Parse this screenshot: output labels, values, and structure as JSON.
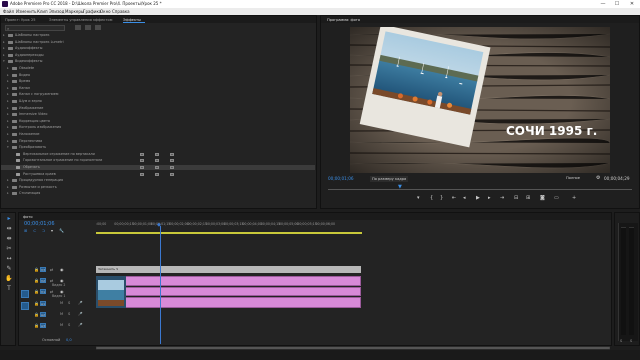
{
  "titlebar": {
    "title": "Adobe Premiere Pro CC 2018 - D:\\Школа Premier Pro\\4. Проекты\\Урок 25 *",
    "min": "—",
    "max": "☐",
    "close": "✕"
  },
  "menu": [
    "Файл",
    "Изменить",
    "Клип",
    "Эпизод",
    "Маркеры",
    "Графика",
    "Окно",
    "Справка"
  ],
  "effects_panel": {
    "tabs": [
      "Проект: Урок 25",
      "Элементы управления эффектом",
      "Эффекты"
    ],
    "tree": [
      {
        "label": "Шаблоны настроек",
        "level": 1,
        "open": false
      },
      {
        "label": "Шаблоны настроек Lumetri",
        "level": 1,
        "open": false
      },
      {
        "label": "Аудиоэффекты",
        "level": 1,
        "open": false
      },
      {
        "label": "Аудиопереходы",
        "level": 1,
        "open": false
      },
      {
        "label": "Видеоэффекты",
        "level": 1,
        "open": true
      },
      {
        "label": "Obsolete",
        "level": 2,
        "open": false
      },
      {
        "label": "Видео",
        "level": 2,
        "open": false
      },
      {
        "label": "Время",
        "level": 2,
        "open": false
      },
      {
        "label": "Канал",
        "level": 2,
        "open": false
      },
      {
        "label": "Канал с погружением",
        "level": 2,
        "open": false
      },
      {
        "label": "Шум и зерно",
        "level": 2,
        "open": false
      },
      {
        "label": "Изображение",
        "level": 2,
        "open": false
      },
      {
        "label": "Immersive Video",
        "level": 2,
        "open": false
      },
      {
        "label": "Коррекция цвета",
        "level": 2,
        "open": false
      },
      {
        "label": "Контроль изображения",
        "level": 2,
        "open": false
      },
      {
        "label": "Наложение",
        "level": 2,
        "open": false
      },
      {
        "label": "Перспектива",
        "level": 2,
        "open": false
      },
      {
        "label": "Преобразовать",
        "level": 2,
        "open": true
      },
      {
        "label": "Вертикальное отражение по вертикали",
        "level": 3,
        "badge": true
      },
      {
        "label": "Горизонтальное отражение по горизонтали",
        "level": 3,
        "badge": true
      },
      {
        "label": "Обрезать",
        "level": 3,
        "badge": true,
        "selected": true
      },
      {
        "label": "Растушевка краев",
        "level": 3,
        "badge": true
      },
      {
        "label": "Процедурная генерация",
        "level": 2,
        "open": false
      },
      {
        "label": "Размытие и резкость",
        "level": 2,
        "open": false
      },
      {
        "label": "Стилизация",
        "level": 2,
        "open": false
      }
    ]
  },
  "program_monitor": {
    "tab": "Программа: фото",
    "overlay_text": "СОЧИ 1995 г.",
    "timecode": "00;00;01;06",
    "fit": "По размеру кадра",
    "quality": "Полное",
    "duration": "00;00;04;29",
    "controls": [
      "mark-in",
      "mark-out",
      "go-in",
      "step-back",
      "play",
      "step-forward",
      "go-out",
      "insert",
      "overwrite",
      "export-frame",
      "button-editor"
    ]
  },
  "timeline": {
    "tab": "фото",
    "timecode": "00;00;01;06",
    "ruler": [
      ":00;00",
      "00;00;00;15",
      "00;00;01;00",
      "00;00;01;15",
      "00;00;02;00",
      "00;00;02;15",
      "00;00;03;00",
      "00;00;03;15",
      "00;00;04;00",
      "00;00;04;15",
      "00;00;05;00",
      "00;00;05;15",
      "00;00;06;00"
    ],
    "tracks": [
      {
        "id": "V3",
        "name": ""
      },
      {
        "id": "V2",
        "name": "Видео 2"
      },
      {
        "id": "V1",
        "name": "Видео 1"
      },
      {
        "id": "A1",
        "name": ""
      },
      {
        "id": "A2",
        "name": ""
      },
      {
        "id": "A3",
        "name": ""
      }
    ],
    "master": "Основной",
    "master_value": "0,0",
    "clip_label": "Затемнить Ч",
    "s_label": "S"
  },
  "tools": [
    "▸",
    "⇹",
    "⇼",
    "◆",
    "✂",
    "↔",
    "✎",
    "✋",
    "T"
  ],
  "colors": {
    "clip_pink": "#d88ad8",
    "clip_gray": "#b8b8b8",
    "accent_blue": "#3a8ee6",
    "playhead": "#3b78d0"
  }
}
